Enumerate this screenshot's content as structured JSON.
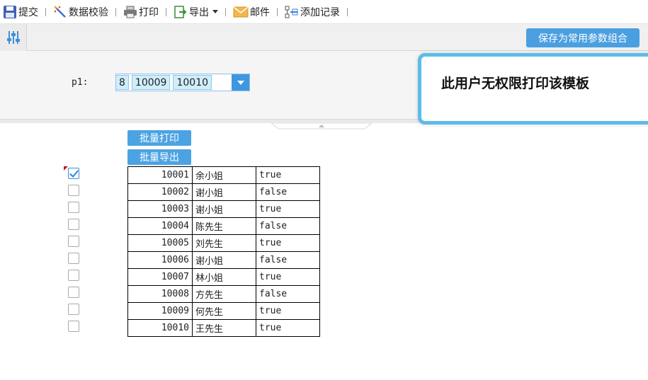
{
  "toolbar": {
    "submit": "提交",
    "validate": "数据校验",
    "print": "打印",
    "export": "导出",
    "mail": "邮件",
    "add_record": "添加记录"
  },
  "param_bar": {
    "save_label": "保存为常用参数组合"
  },
  "param": {
    "label": "p1:",
    "tags": [
      "8",
      "10009",
      "10010"
    ]
  },
  "toast": {
    "message": "此用户无权限打印该模板"
  },
  "actions": {
    "batch_print": "批量打印",
    "batch_export": "批量导出"
  },
  "rows": [
    {
      "id": "10001",
      "name": "余小姐",
      "flag": "true",
      "checked": true
    },
    {
      "id": "10002",
      "name": "谢小姐",
      "flag": "false",
      "checked": false
    },
    {
      "id": "10003",
      "name": "谢小姐",
      "flag": "true",
      "checked": false
    },
    {
      "id": "10004",
      "name": "陈先生",
      "flag": "false",
      "checked": false
    },
    {
      "id": "10005",
      "name": "刘先生",
      "flag": "true",
      "checked": false
    },
    {
      "id": "10006",
      "name": "谢小姐",
      "flag": "false",
      "checked": false
    },
    {
      "id": "10007",
      "name": "林小姐",
      "flag": "true",
      "checked": false
    },
    {
      "id": "10008",
      "name": "方先生",
      "flag": "false",
      "checked": false
    },
    {
      "id": "10009",
      "name": "何先生",
      "flag": "true",
      "checked": false
    },
    {
      "id": "10010",
      "name": "王先生",
      "flag": "true",
      "checked": false
    }
  ],
  "colors": {
    "accent": "#4ba3e3",
    "toast_border": "#5bbde6",
    "tag_bg": "#cfeefc"
  }
}
